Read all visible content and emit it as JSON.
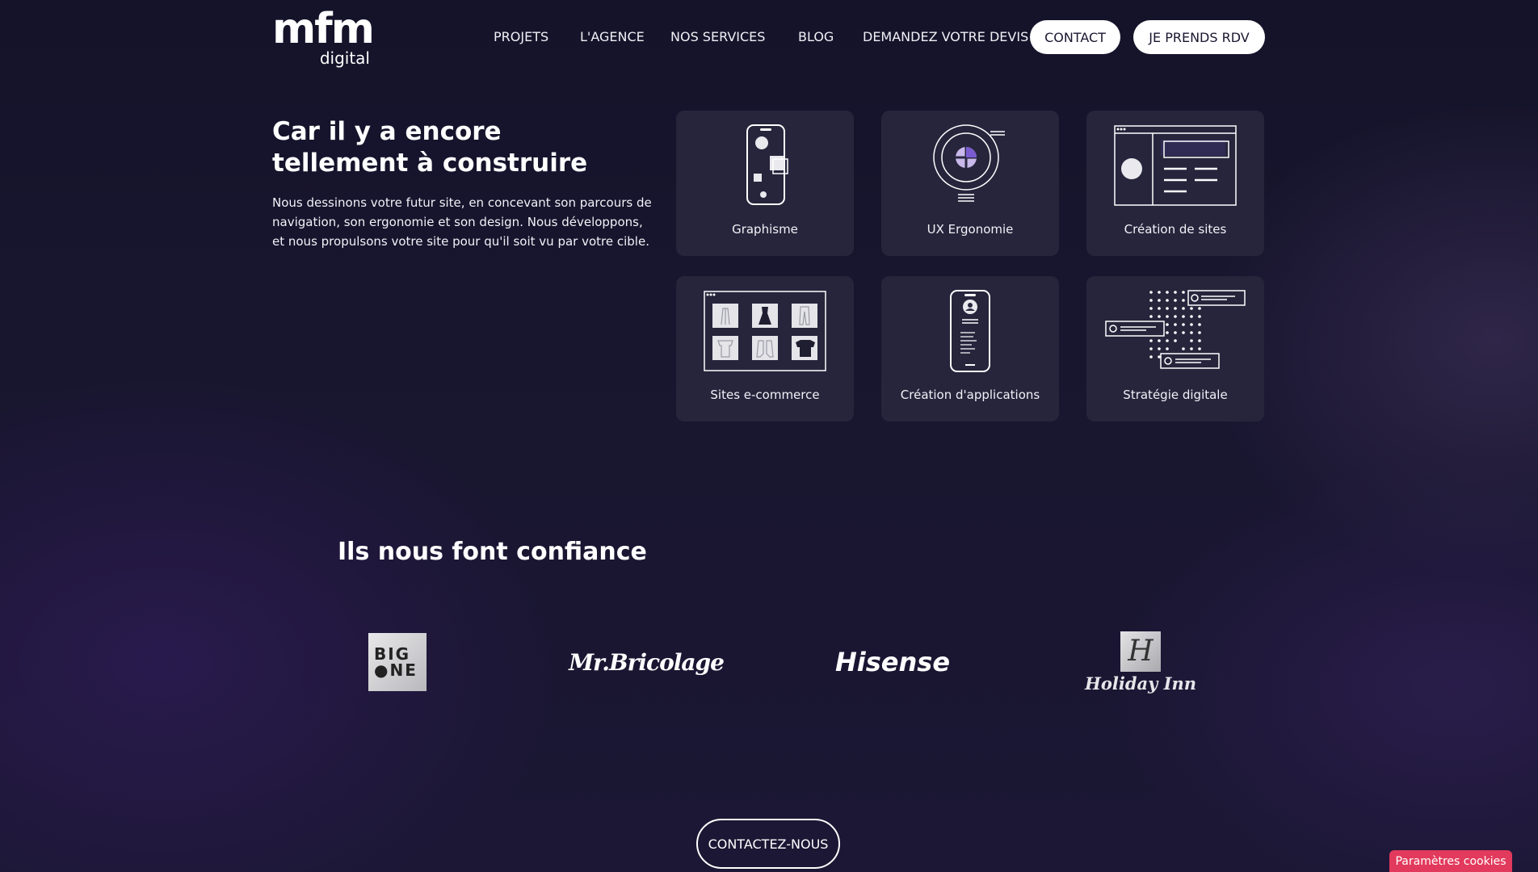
{
  "header": {
    "logo_mark": "mfm",
    "logo_sub": "digital",
    "nav": [
      "PROJETS",
      "L'AGENCE",
      "NOS SERVICES",
      "BLOG",
      "DEMANDEZ VOTRE DEVIS"
    ],
    "contact_label": "CONTACT",
    "rdv_label": "JE PRENDS RDV"
  },
  "hero": {
    "title": "Car il y a encore tellement à construire",
    "text": "Nous dessinons votre futur site, en concevant son parcours de navigation, son ergonomie et son design. Nous développons, et nous propulsons votre site pour qu'il soit vu par votre cible."
  },
  "services": [
    {
      "label": "Graphisme",
      "icon": "phone-shapes-icon"
    },
    {
      "label": "UX Ergonomie",
      "icon": "ux-target-icon"
    },
    {
      "label": "Création de sites",
      "icon": "website-browser-icon"
    },
    {
      "label": "Sites e-commerce",
      "icon": "ecommerce-grid-icon"
    },
    {
      "label": "Création d'applications",
      "icon": "mobile-app-icon"
    },
    {
      "label": "Stratégie digitale",
      "icon": "strategy-dots-icon"
    }
  ],
  "trust": {
    "title": "Ils nous font confiance",
    "clients": [
      {
        "name": "BIG ONE",
        "line1": "BIG",
        "line2": "●NE"
      },
      {
        "name": "Mr.Bricolage"
      },
      {
        "name": "Hisense"
      },
      {
        "name": "Holiday Inn",
        "mark": "H"
      }
    ]
  },
  "cta_label": "CONTACTEZ-NOUS",
  "cookie_label": "Paramètres cookies"
}
